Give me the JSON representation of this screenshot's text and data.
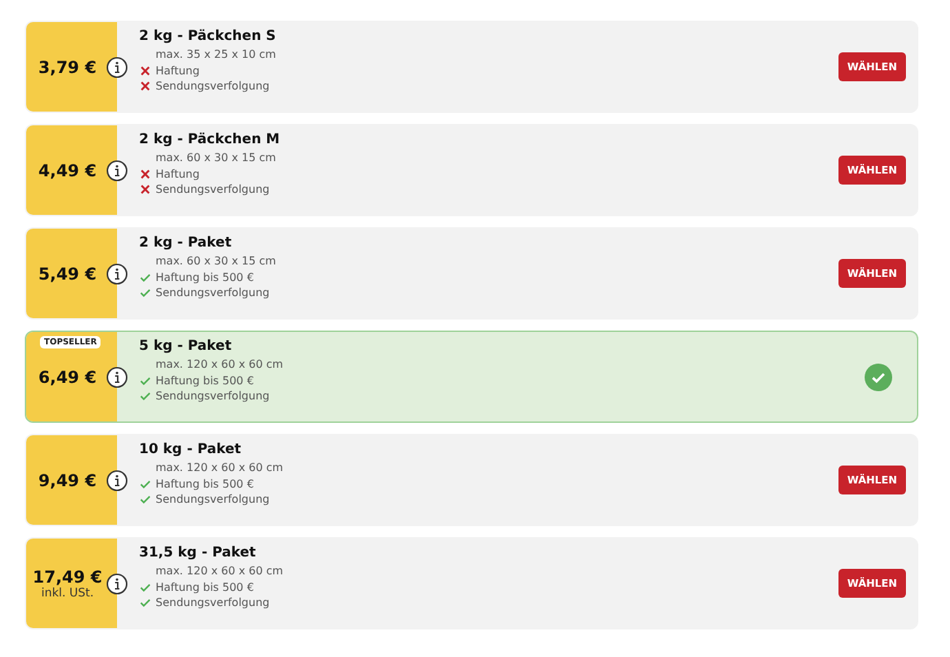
{
  "options": [
    {
      "price": "3,79 €",
      "title": "2 kg - Päckchen S",
      "size": "max. 35 x 25 x 10 cm",
      "features": [
        {
          "kind": "cross",
          "label": "Haftung"
        },
        {
          "kind": "cross",
          "label": "Sendungsverfolgung"
        }
      ],
      "selected": false,
      "button": "WÄHLEN"
    },
    {
      "price": "4,49 €",
      "title": "2 kg - Päckchen M",
      "size": "max. 60 x 30 x 15 cm",
      "features": [
        {
          "kind": "cross",
          "label": "Haftung"
        },
        {
          "kind": "cross",
          "label": "Sendungsverfolgung"
        }
      ],
      "selected": false,
      "button": "WÄHLEN"
    },
    {
      "price": "5,49 €",
      "title": "2 kg - Paket",
      "size": "max. 60 x 30 x 15 cm",
      "features": [
        {
          "kind": "check",
          "label": "Haftung bis 500 €"
        },
        {
          "kind": "check",
          "label": "Sendungsverfolgung"
        }
      ],
      "selected": false,
      "button": "WÄHLEN"
    },
    {
      "badge": "TOPSELLER",
      "price": "6,49 €",
      "title": "5 kg - Paket",
      "size": "max. 120 x 60 x 60 cm",
      "features": [
        {
          "kind": "check",
          "label": "Haftung bis 500 €"
        },
        {
          "kind": "check",
          "label": "Sendungsverfolgung"
        }
      ],
      "selected": true
    },
    {
      "price": "9,49 €",
      "title": "10 kg - Paket",
      "size": "max. 120 x 60 x 60 cm",
      "features": [
        {
          "kind": "check",
          "label": "Haftung bis 500 €"
        },
        {
          "kind": "check",
          "label": "Sendungsverfolgung"
        }
      ],
      "selected": false,
      "button": "WÄHLEN"
    },
    {
      "price": "17,49 €",
      "price_note": "inkl. USt.",
      "title": "31,5 kg - Paket",
      "size": "max. 120 x 60 x 60 cm",
      "features": [
        {
          "kind": "check",
          "label": "Haftung bis 500 €"
        },
        {
          "kind": "check",
          "label": "Sendungsverfolgung"
        }
      ],
      "selected": false,
      "button": "WÄHLEN"
    }
  ]
}
